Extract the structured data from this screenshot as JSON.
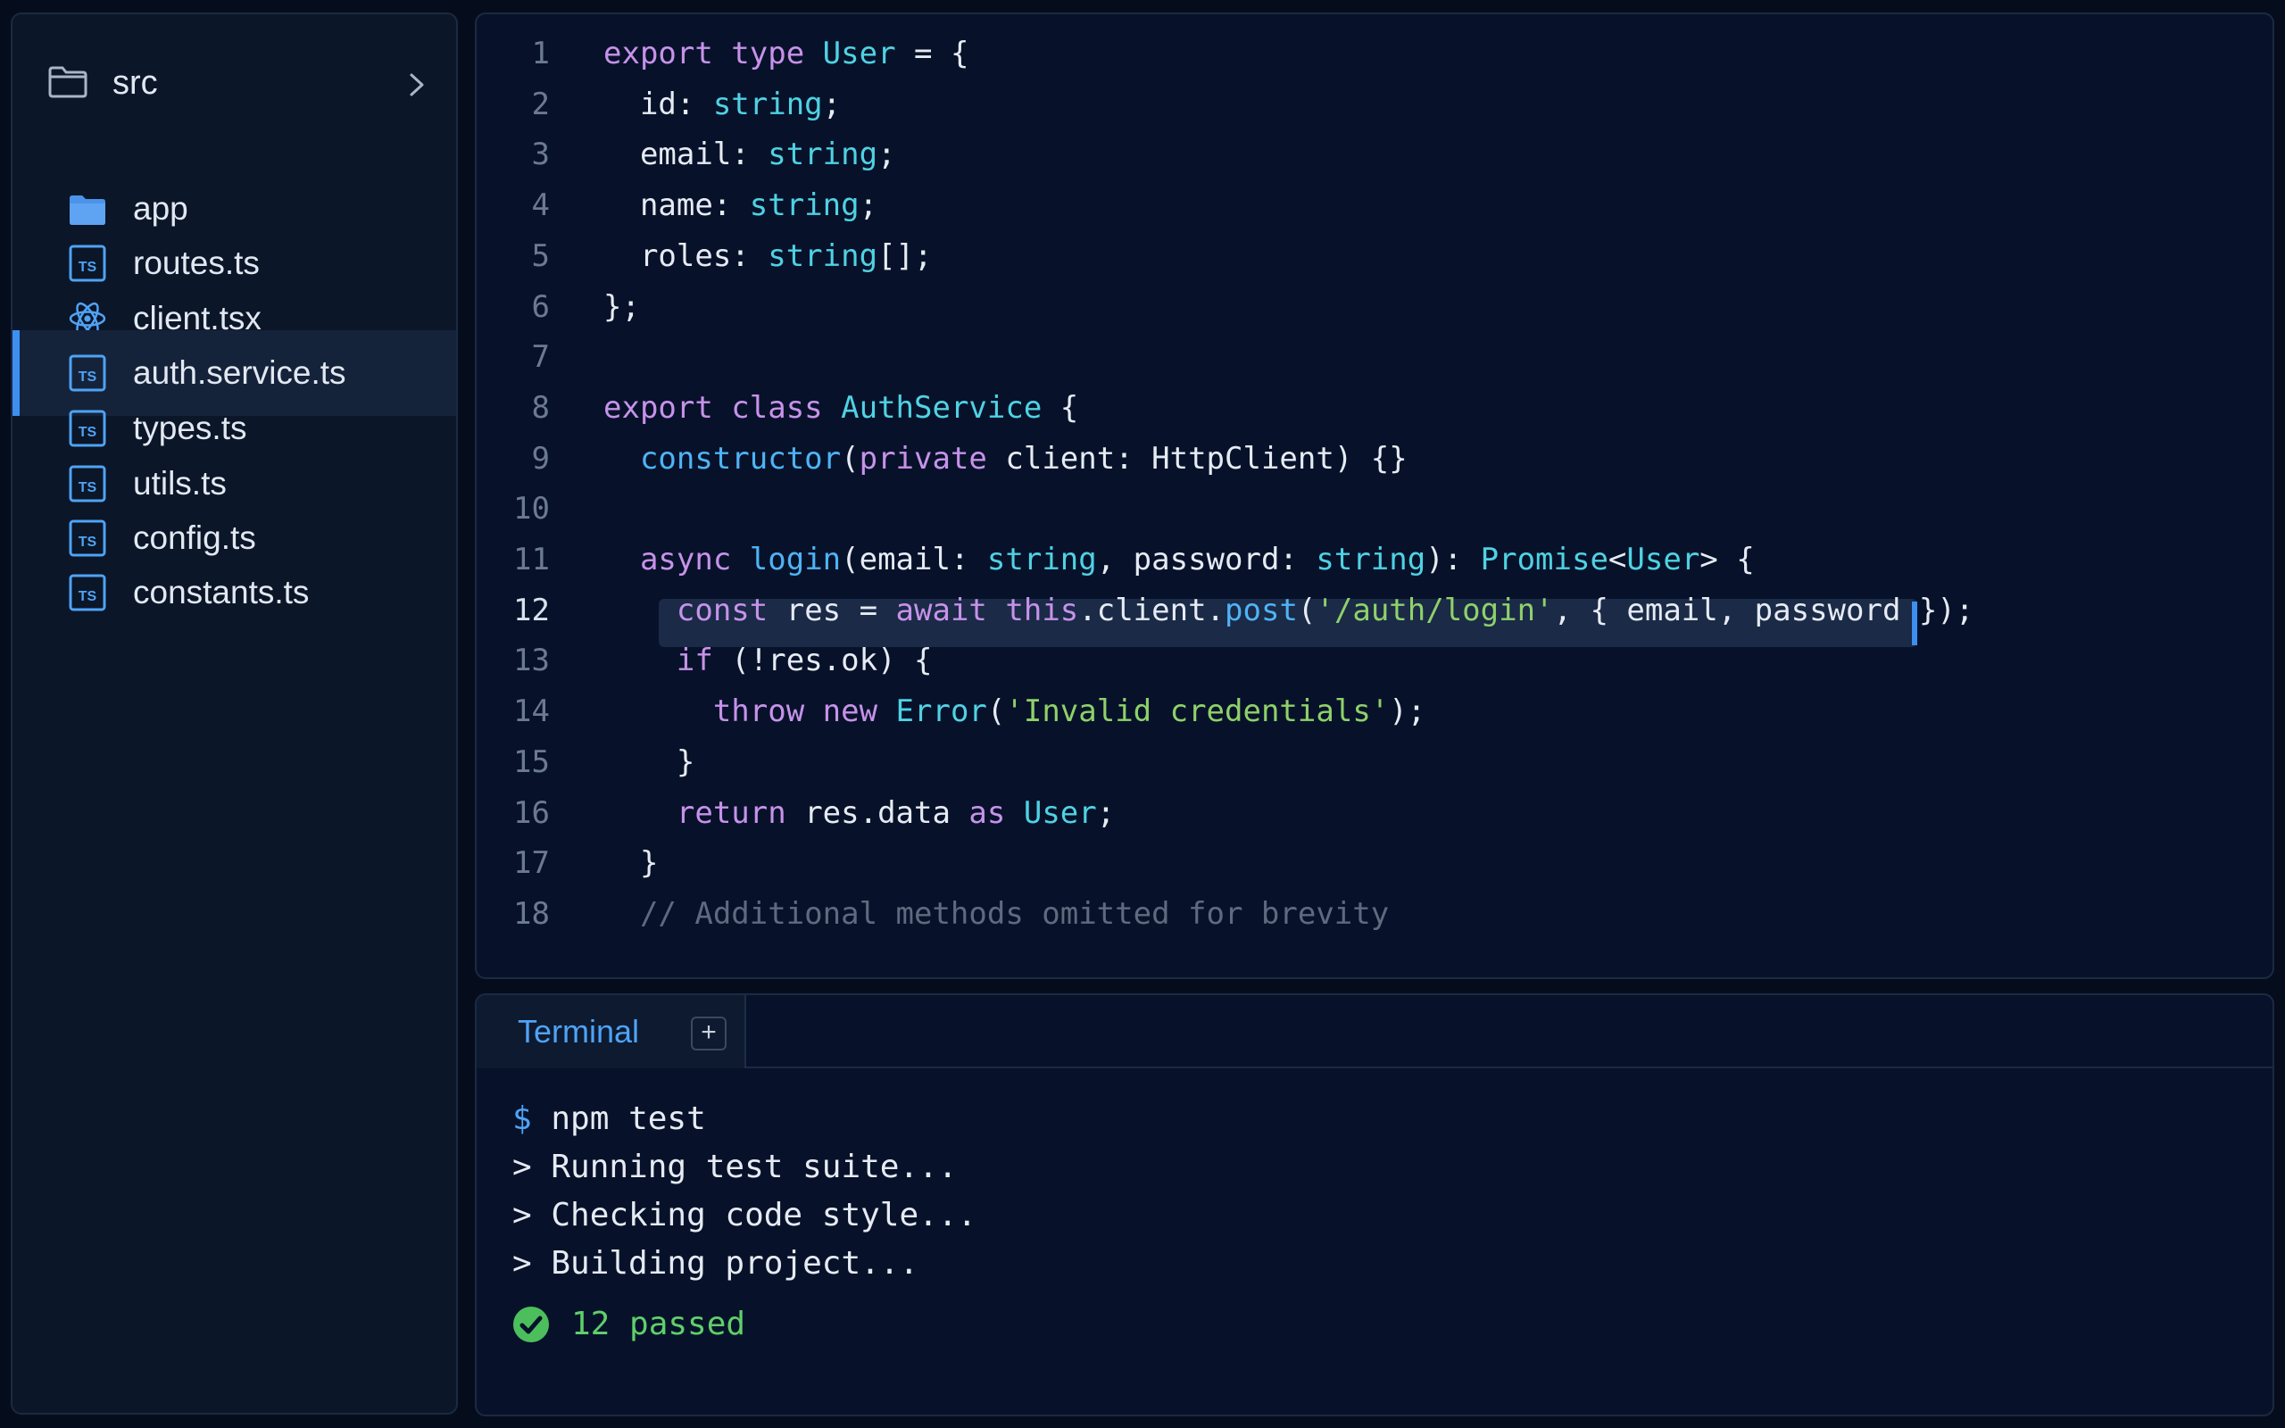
{
  "sidebar": {
    "folder": {
      "label": "src",
      "icon": "folder-icon",
      "chevron_icon": "chevron-right-icon"
    },
    "items": [
      {
        "label": "app",
        "icon": "folder-icon",
        "active": false
      },
      {
        "label": "routes.ts",
        "icon": "typescript-file-icon",
        "active": false
      },
      {
        "label": "client.tsx",
        "icon": "react-icon",
        "active": false
      },
      {
        "label": "auth.service.ts",
        "icon": "typescript-file-icon",
        "active": true
      },
      {
        "label": "types.ts",
        "icon": "typescript-file-icon",
        "active": false
      },
      {
        "label": "utils.ts",
        "icon": "typescript-file-icon",
        "active": false
      },
      {
        "label": "config.ts",
        "icon": "typescript-file-icon",
        "active": false
      },
      {
        "label": "constants.ts",
        "icon": "typescript-file-icon",
        "active": false
      }
    ]
  },
  "editor": {
    "current_line": 12,
    "lines": [
      {
        "n": "1",
        "tokens": [
          [
            "kw",
            "export "
          ],
          [
            "kw",
            "type "
          ],
          [
            "type",
            "User"
          ],
          [
            "pl",
            " = {"
          ]
        ]
      },
      {
        "n": "2",
        "tokens": [
          [
            "pl",
            "  id: "
          ],
          [
            "type",
            "string"
          ],
          [
            "pl",
            ";"
          ]
        ]
      },
      {
        "n": "3",
        "tokens": [
          [
            "pl",
            "  email: "
          ],
          [
            "type",
            "string"
          ],
          [
            "pl",
            ";"
          ]
        ]
      },
      {
        "n": "4",
        "tokens": [
          [
            "pl",
            "  name: "
          ],
          [
            "type",
            "string"
          ],
          [
            "pl",
            ";"
          ]
        ]
      },
      {
        "n": "5",
        "tokens": [
          [
            "pl",
            "  roles: "
          ],
          [
            "type",
            "string"
          ],
          [
            "pl",
            "[];"
          ]
        ]
      },
      {
        "n": "6",
        "tokens": [
          [
            "pl",
            "};"
          ]
        ]
      },
      {
        "n": "7",
        "tokens": []
      },
      {
        "n": "8",
        "tokens": [
          [
            "kw",
            "export "
          ],
          [
            "kw",
            "class "
          ],
          [
            "type",
            "AuthService"
          ],
          [
            "pl",
            " {"
          ]
        ]
      },
      {
        "n": "9",
        "tokens": [
          [
            "pl",
            "  "
          ],
          [
            "fn",
            "constructor"
          ],
          [
            "pl",
            "("
          ],
          [
            "kw",
            "private "
          ],
          [
            "pl",
            "client: HttpClient) {}"
          ]
        ]
      },
      {
        "n": "10",
        "tokens": []
      },
      {
        "n": "11",
        "tokens": [
          [
            "pl",
            "  "
          ],
          [
            "kw",
            "async "
          ],
          [
            "fn",
            "login"
          ],
          [
            "pl",
            "(email: "
          ],
          [
            "type",
            "string"
          ],
          [
            "pl",
            ", password: "
          ],
          [
            "type",
            "string"
          ],
          [
            "pl",
            "): "
          ],
          [
            "type",
            "Promise"
          ],
          [
            "pl",
            "<"
          ],
          [
            "type",
            "User"
          ],
          [
            "pl",
            "> {"
          ]
        ]
      },
      {
        "n": "12",
        "tokens": [
          [
            "pl",
            "    "
          ],
          [
            "kw",
            "const "
          ],
          [
            "pl",
            "res = "
          ],
          [
            "kw",
            "await "
          ],
          [
            "kw",
            "this"
          ],
          [
            "pl",
            ".client."
          ],
          [
            "fn",
            "post"
          ],
          [
            "pl",
            "("
          ],
          [
            "str",
            "'/auth/login'"
          ],
          [
            "pl",
            ", { email, password });"
          ]
        ]
      },
      {
        "n": "13",
        "tokens": [
          [
            "pl",
            "    "
          ],
          [
            "kw",
            "if "
          ],
          [
            "pl",
            "(!res.ok) {"
          ]
        ]
      },
      {
        "n": "14",
        "tokens": [
          [
            "pl",
            "      "
          ],
          [
            "kw",
            "throw "
          ],
          [
            "kw",
            "new "
          ],
          [
            "type",
            "Error"
          ],
          [
            "pl",
            "("
          ],
          [
            "str",
            "'Invalid credentials'"
          ],
          [
            "pl",
            ");"
          ]
        ]
      },
      {
        "n": "15",
        "tokens": [
          [
            "pl",
            "    }"
          ]
        ]
      },
      {
        "n": "16",
        "tokens": [
          [
            "pl",
            "    "
          ],
          [
            "kw",
            "return "
          ],
          [
            "pl",
            "res.data "
          ],
          [
            "kw",
            "as "
          ],
          [
            "type",
            "User"
          ],
          [
            "pl",
            ";"
          ]
        ]
      },
      {
        "n": "17",
        "tokens": [
          [
            "pl",
            "  }"
          ]
        ]
      },
      {
        "n": "18",
        "tokens": [
          [
            "cmt",
            "  // Additional methods omitted for brevity"
          ]
        ]
      }
    ]
  },
  "terminal": {
    "tab_label": "Terminal",
    "add_label": "+",
    "prompt": "$",
    "command": "npm test",
    "output": [
      "> Running test suite...",
      "> Checking code style...",
      "> Building project..."
    ],
    "result": "12 passed",
    "result_icon": "check-circle-icon"
  },
  "colors": {
    "accent": "#3d8ff0",
    "keyword": "#c792ea",
    "type": "#4fd2e3",
    "function": "#4fb3f5",
    "string": "#8fd16a",
    "comment": "#5e6a7e",
    "success": "#5fcf6a"
  }
}
